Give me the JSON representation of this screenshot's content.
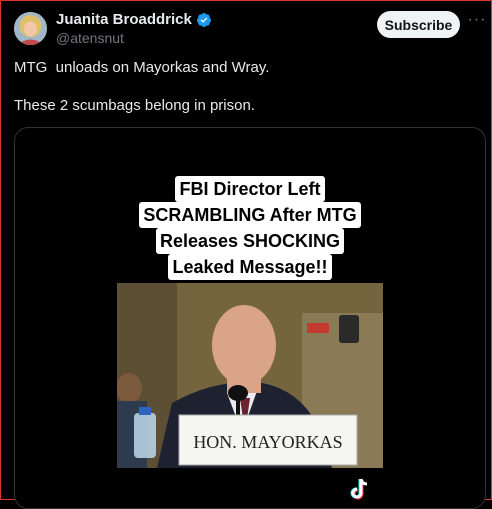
{
  "author": {
    "display_name": "Juanita Broaddrick",
    "handle": "@atensnut",
    "verified": true,
    "avatar_icon": "avatar-photo"
  },
  "actions": {
    "subscribe_label": "Subscribe",
    "more_icon": "more-horizontal-icon"
  },
  "tweet": {
    "line1": "MTG  unloads on Mayorkas and Wray.",
    "line2": "These 2 scumbags belong in prison."
  },
  "media": {
    "caption_lines": [
      "FBI Director Left",
      "SCRAMBLING After MTG",
      "Releases SHOCKING",
      "Leaked Message!!"
    ],
    "nameplate": "HON. MAYORKAS",
    "watermark_icon": "tiktok-icon"
  },
  "colors": {
    "background": "#000000",
    "text": "#e7e9ea",
    "secondary": "#71767b",
    "verified": "#1d9bf0",
    "subscribe_bg": "#eff3f4"
  }
}
